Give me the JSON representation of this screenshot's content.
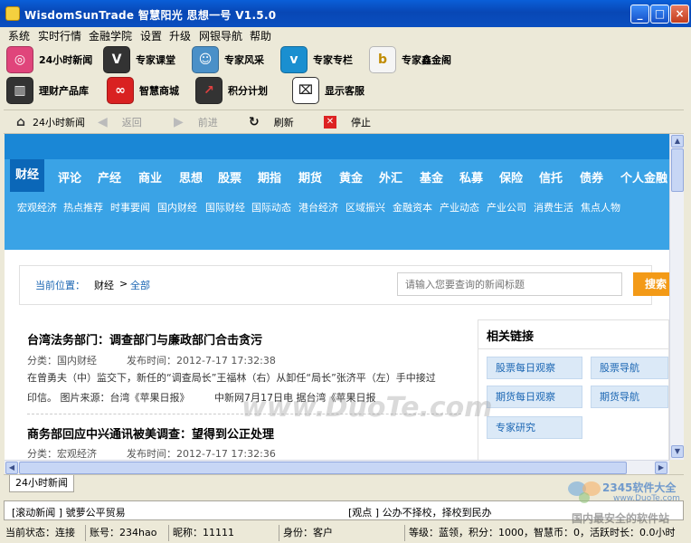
{
  "window": {
    "title": "WisdomSunTrade 智慧阳光 思想一号 V1.5.0",
    "min": "_",
    "max": "□",
    "close": "×"
  },
  "menu": [
    "系统",
    "实时行情",
    "金融学院",
    "设置",
    "升级",
    "网银导航",
    "帮助"
  ],
  "toolbar": {
    "row1": [
      {
        "label": "24小时新闻",
        "icon": "dribbble-icon",
        "color": "#e0457b",
        "glyph": "◎"
      },
      {
        "label": "专家课堂",
        "icon": "vine-v-icon",
        "color": "#333333",
        "glyph": "V"
      },
      {
        "label": "专家风采",
        "icon": "people-icon",
        "color": "#4a90c8",
        "glyph": "☺"
      },
      {
        "label": "专家专栏",
        "icon": "vimeo-icon",
        "color": "#1a8fd0",
        "glyph": "v"
      },
      {
        "label": "专家鑫金阁",
        "icon": "b-icon",
        "color": "#f5b400",
        "glyph": "b"
      }
    ],
    "row2": [
      {
        "label": "理财产品库",
        "icon": "bar-chart-icon",
        "color": "#333333",
        "glyph": "▥"
      },
      {
        "label": "智慧商城",
        "icon": "lastfm-icon",
        "color": "#d92121",
        "glyph": "∞"
      },
      {
        "label": "积分计划",
        "icon": "trend-icon",
        "color": "#333333",
        "glyph": "↗"
      },
      {
        "label": "显示客服",
        "icon": "window-cursor-icon",
        "color": "#444444",
        "glyph": "⌧"
      }
    ]
  },
  "nav": {
    "home": "24小时新闻",
    "back": "返回",
    "forward": "前进",
    "refresh": "刷新",
    "stop": "停止"
  },
  "categories": [
    "财经",
    "评论",
    "产经",
    "商业",
    "思想",
    "股票",
    "期指",
    "期货",
    "黄金",
    "外汇",
    "基金",
    "私募",
    "保险",
    "信托",
    "债券",
    "个人金融"
  ],
  "subcategories": [
    "宏观经济",
    "热点推荐",
    "时事要闻",
    "国内财经",
    "国际财经",
    "国际动态",
    "港台经济",
    "区域振兴",
    "金融资本",
    "产业动态",
    "产业公司",
    "消费生活",
    "焦点人物"
  ],
  "breadcrumb": {
    "label": "当前位置：",
    "section": "财经",
    "sep": ">",
    "current": "全部"
  },
  "search": {
    "placeholder": "请输入您要查询的新闻标题",
    "button": "搜索"
  },
  "articles": [
    {
      "title": "台湾法务部门：调查部门与廉政部门合击贪污",
      "meta": "分类：国内财经　　　发布时间：2012-7-17 17:32:38",
      "line1": "在曾勇夫（中）监交下，新任的“调查局长”王福林（右）从卸任“局长”张济平（左）手中接过",
      "line2": "印信。 图片来源：台湾《苹果日报》　　　中新网7月17日电 据台湾《苹果日报"
    },
    {
      "title": "商务部回应中兴通讯被美调查：望得到公正处理",
      "meta": "分类：宏观经济　　　发布时间：2012-7-17 17:32:36"
    }
  ],
  "related": {
    "title": "相关链接",
    "links": [
      "股票每日观察",
      "股票导航",
      "期货每日观察",
      "期货导航",
      "专家研究"
    ]
  },
  "bottom_tab": "24小时新闻",
  "ticker": {
    "left": "[滚动新闻 ] 號萝公平贸易",
    "right": "[观点 ] 公办不择校，择校到民办"
  },
  "status": {
    "state": "当前状态：连接",
    "account": "账号：234hao",
    "nickname": "昵称：11111",
    "identity": "身份：客户",
    "level": "等级：蓝领，积分：1000，智慧币：0，活跃时长：0.0小时"
  },
  "watermark": "www.DuoTe.com",
  "logo": {
    "brand": "2345软件大全",
    "url": "www.DuoTe.com",
    "slogan": "国内最安全的软件站"
  }
}
